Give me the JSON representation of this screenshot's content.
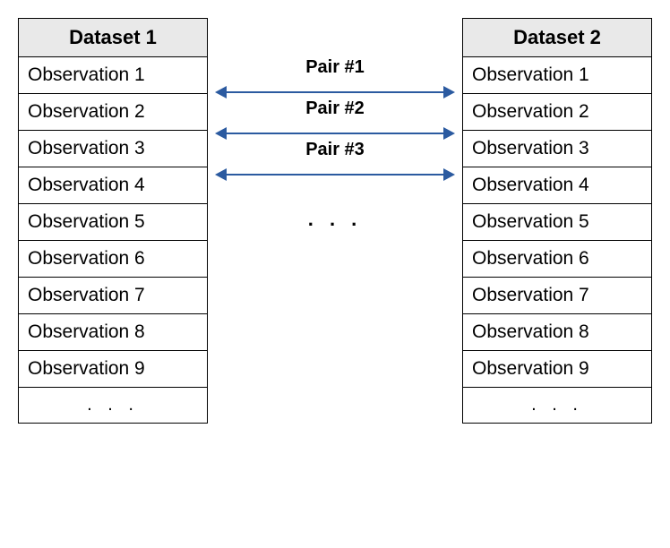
{
  "left": {
    "header": "Dataset 1",
    "rows": [
      "Observation 1",
      "Observation 2",
      "Observation 3",
      "Observation 4",
      "Observation 5",
      "Observation 6",
      "Observation 7",
      "Observation 8",
      "Observation 9",
      ". . ."
    ]
  },
  "right": {
    "header": "Dataset 2",
    "rows": [
      "Observation 1",
      "Observation 2",
      "Observation 3",
      "Observation 4",
      "Observation 5",
      "Observation 6",
      "Observation 7",
      "Observation 8",
      "Observation 9",
      ". . ."
    ]
  },
  "pairs": {
    "labels": [
      "Pair #1",
      "Pair #2",
      "Pair #3"
    ],
    "ellipsis": ". . .",
    "arrow_color": "#2b5aa0"
  }
}
